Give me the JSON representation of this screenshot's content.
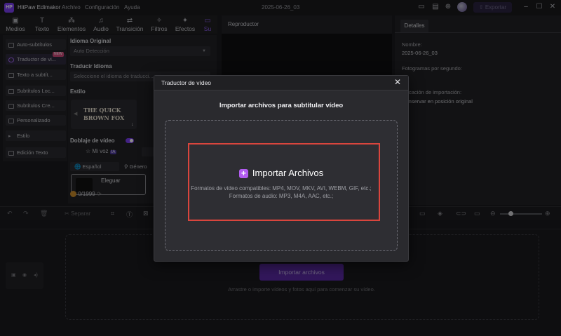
{
  "titlebar": {
    "logo": "HP",
    "app_name": "HitPaw Edimakor",
    "menu": [
      "Archivo",
      "Configuración",
      "Ayuda"
    ],
    "doc_title": "2025-06-26_03",
    "export_label": "Exportar",
    "icons": [
      "layout-icon",
      "message-icon",
      "download-icon",
      "grid-icon",
      "avatar",
      "minimize-icon",
      "maximize-icon",
      "close-icon"
    ]
  },
  "tabs": [
    "Medios",
    "Texto",
    "Elementos",
    "Audio",
    "Transición",
    "Filtros",
    "Efectos",
    "Su"
  ],
  "sidebar": {
    "items": [
      "Auto-subtítulos",
      "Traductor de vi...",
      "Texto a subtít...",
      "Subtítulos Loc...",
      "Subtítulos Cre...",
      "Personalizado",
      "Estilo",
      "Edición Texto"
    ],
    "new_badge": "NEW"
  },
  "settings": {
    "idioma_original_label": "Idioma Original",
    "idioma_original_value": "Auto Detección",
    "traducir_label": "Traducir Idioma",
    "traducir_placeholder": "Seleccione el idioma de traducci...",
    "estilo_label": "Estilo",
    "estilo_preview_line1": "THE QUICK",
    "estilo_preview_line2": "BROWN FOX",
    "doblaje_label": "Doblaje de vídeo",
    "mi_voz_label": "Mi voz",
    "ia_badge": "IA",
    "lang_value": "Español",
    "genero_value": "Género",
    "voice_name": "Eleguar",
    "credits": "0/1999"
  },
  "player": {
    "title": "Reproductor"
  },
  "details": {
    "tab": "Detalles",
    "nombre_label": "Nombre:",
    "nombre_value": "2025-06-26_03",
    "fps_label": "Fotogramas por segundo:",
    "import_loc_label": "ubicación de importación:",
    "import_loc_value": "Conservar en posición original"
  },
  "timeline_toolbar": {
    "separar": "Separar"
  },
  "timeline": {
    "import_button": "Importar archivos",
    "hint": "Arrastre o importe vídeos y fotos aquí para comenzar su vídeo."
  },
  "modal": {
    "title": "Traductor de vídeo",
    "subtitle": "Importar archivos para subtitular vídeo",
    "import_label": "Importar Archivos",
    "video_formats": "Formatos de vídeo compatibles: MP4, MOV, MKV, AVI, WEBM, GIF, etc.;",
    "audio_formats": "Formatos de audio: MP3, M4A, AAC, etc.;"
  },
  "colors": {
    "accent": "#7b3ff2",
    "highlight": "#d9453d",
    "plus": "#b25cf0"
  }
}
